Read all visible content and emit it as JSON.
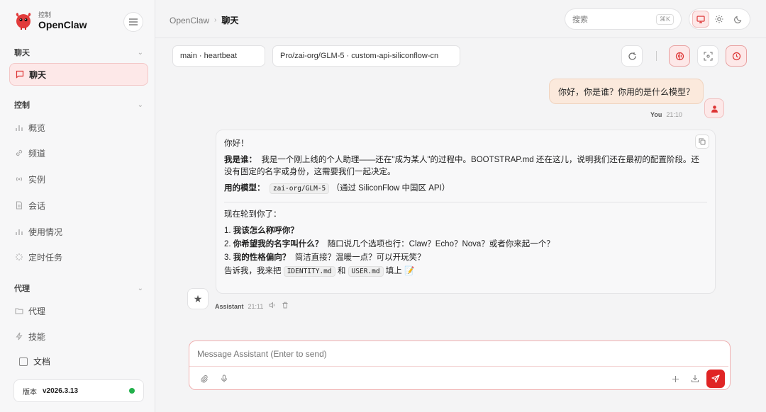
{
  "brand": {
    "sub": "控制",
    "name": "OpenClaw"
  },
  "sidebar": {
    "sections": [
      {
        "label": "聊天"
      },
      {
        "label": "控制"
      },
      {
        "label": "代理"
      }
    ],
    "items": [
      {
        "label": "聊天",
        "icon": "chat-icon",
        "active": true
      },
      {
        "label": "概览",
        "icon": "bar-chart-icon"
      },
      {
        "label": "频道",
        "icon": "link-icon"
      },
      {
        "label": "实例",
        "icon": "radio-icon"
      },
      {
        "label": "会话",
        "icon": "file-icon"
      },
      {
        "label": "使用情况",
        "icon": "bar-chart-icon"
      },
      {
        "label": "定时任务",
        "icon": "loader-icon"
      },
      {
        "label": "代理",
        "icon": "folder-icon"
      },
      {
        "label": "技能",
        "icon": "bolt-icon"
      }
    ],
    "docs": "文档",
    "version_label": "版本",
    "version_value": "v2026.3.13",
    "status_color": "#22b04b"
  },
  "header": {
    "crumb_root": "OpenClaw",
    "crumb_current": "聊天",
    "search_placeholder": "搜索",
    "search_shortcut": "⌘K"
  },
  "toolbar": {
    "session": "main · heartbeat",
    "model": "Pro/zai-org/GLM-5 · custom-api-siliconflow-cn"
  },
  "messages": {
    "user": {
      "text": "你好，你是谁？你用的是什么模型？",
      "sender": "You",
      "time": "21:10"
    },
    "assistant": {
      "greeting": "你好！",
      "who_label": "我是谁：",
      "who_text": "我是一个刚上线的个人助理——还在\"成为某人\"的过程中。BOOTSTRAP.md 还在这儿，说明我们还在最初的配置阶段。还没有固定的名字或身份，这需要我们一起决定。",
      "model_label": "用的模型：",
      "model_code": "zai-org/GLM-5",
      "model_note": "（通过 SiliconFlow 中国区 API）",
      "turn_text": "现在轮到你了：",
      "q1_num": "1.",
      "q1": "我该怎么称呼你？",
      "q2_num": "2.",
      "q2": "你希望我的名字叫什么？",
      "q2_note": "随口说几个选项也行：Claw？Echo？Nova？或者你来起一个？",
      "q3_num": "3.",
      "q3": "我的性格偏向？",
      "q3_note": "简洁直接？温暖一点？可以开玩笑？",
      "tell_pre": "告诉我，我来把",
      "tell_code1": "IDENTITY.md",
      "tell_mid": "和",
      "tell_code2": "USER.md",
      "tell_post": "填上 📝",
      "sender": "Assistant",
      "time": "21:11"
    }
  },
  "composer": {
    "placeholder": "Message Assistant (Enter to send)"
  },
  "colors": {
    "accent": "#e02424",
    "accent_soft": "#fde8e8",
    "user_bubble": "#fbe9dc"
  }
}
